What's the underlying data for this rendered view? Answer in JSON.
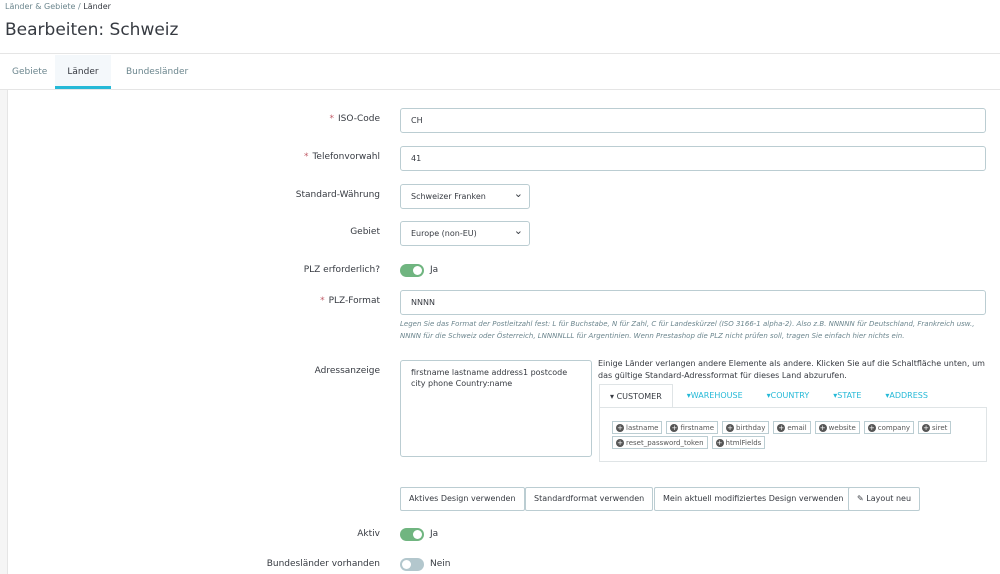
{
  "breadcrumb": {
    "parent": "Länder & Gebiete",
    "separator": "/",
    "current": "Länder"
  },
  "title": "Bearbeiten: Schweiz",
  "tabs": [
    "Gebiete",
    "Länder",
    "Bundesländer"
  ],
  "form": {
    "iso": {
      "label": "ISO-Code",
      "value": "CH"
    },
    "phone": {
      "label": "Telefonvorwahl",
      "value": "41"
    },
    "currency": {
      "label": "Standard-Währung",
      "value": "Schweizer Franken"
    },
    "zone": {
      "label": "Gebiet",
      "value": "Europe (non-EU)"
    },
    "zip_required": {
      "label": "PLZ erforderlich?",
      "value": "Ja"
    },
    "zip_format": {
      "label": "PLZ-Format",
      "value": "NNNN",
      "help": "Legen Sie das Format der Postleitzahl fest: L für Buchstabe, N für Zahl, C für Landeskürzel (ISO 3166-1 alpha-2). Also z.B. NNNNN für Deutschland, Frankreich usw., NNNN für die Schweiz oder Österreich, LNNNNLLL für Argentinien. Wenn Prestashop die PLZ nicht prüfen soll, tragen Sie einfach hier nichts ein."
    },
    "address": {
      "label": "Adressanzeige",
      "value": "firstname lastname address1 postcode city phone Country:name",
      "info": "Einige Länder verlangen andere Elemente als andere. Klicken Sie auf die Schaltfläche unten, um das gültige Standard-Adressformat für dieses Land abzurufen.",
      "field_tabs": [
        "CUSTOMER",
        "WAREHOUSE",
        "COUNTRY",
        "STATE",
        "ADDRESS"
      ],
      "fields": [
        "lastname",
        "firstname",
        "birthday",
        "email",
        "website",
        "company",
        "siret",
        "reset_password_token",
        "htmlFields"
      ]
    },
    "buttons": [
      "Aktives Design verwenden",
      "Standardformat verwenden",
      "Mein aktuell modifiziertes Design verwenden",
      "Layout neu"
    ],
    "active": {
      "label": "Aktiv",
      "value": "Ja"
    },
    "states": {
      "label": "Bundesländer vorhanden",
      "value": "Nein"
    }
  }
}
